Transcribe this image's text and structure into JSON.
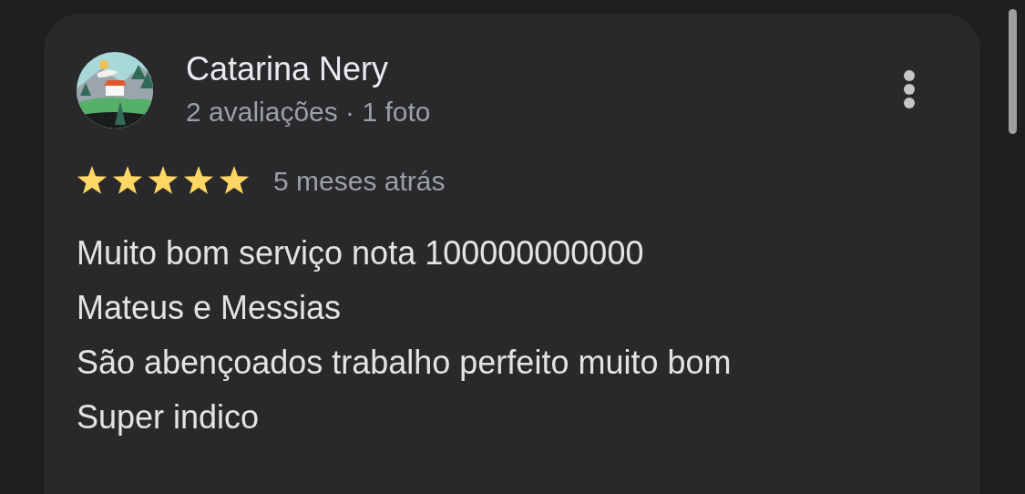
{
  "review": {
    "author": "Catarina Nery",
    "meta": "2 avaliações · 1 foto",
    "stars": 5,
    "time": "5 meses atrás",
    "text": "Muito bom serviço nota 100000000000\nMateus e Messias\nSão abençoados trabalho perfeito muito bom\nSuper indico"
  }
}
